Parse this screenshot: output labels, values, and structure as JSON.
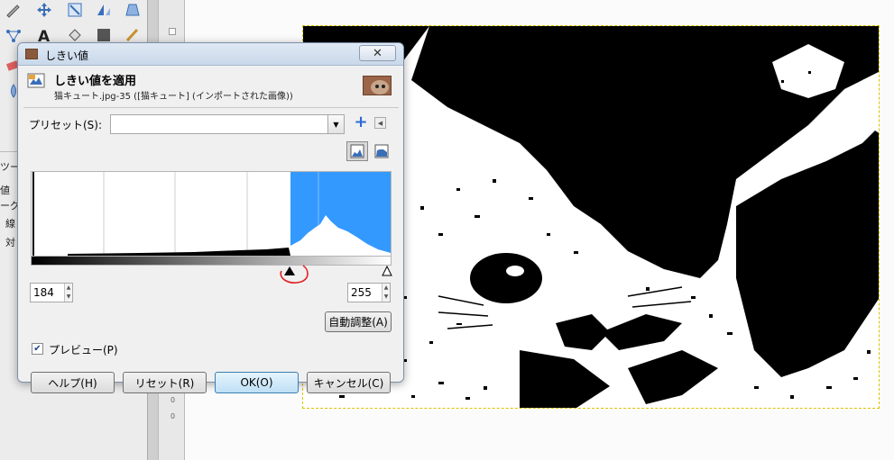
{
  "dialog": {
    "window_title": "しきい値",
    "close_label": "✕",
    "header_title": "しきい値を適用",
    "header_subtitle": "猫キュート.jpg-35 ([猫キュート] (インポートされた画像))",
    "preset_label": "プリセット(S):",
    "preset_value": "",
    "preset_add_icon": "plus-icon",
    "channel_low": "184",
    "channel_high": "255",
    "auto_button": "自動調整(A)",
    "preview_label": "プレビュー(P)",
    "preview_checked": true,
    "buttons": {
      "help": "ヘルプ(H)",
      "reset": "リセット(R)",
      "ok": "OK(O)",
      "cancel": "キャンセル(C)"
    },
    "histogram": {
      "threshold_low": 184,
      "threshold_high": 255,
      "range_max": 255,
      "selected_color": "#3399ff"
    }
  },
  "toolbox": {
    "side_labels": [
      "ツー",
      "値",
      "ーグ",
      "線",
      "対"
    ]
  },
  "colors": {
    "accent": "#3399ff",
    "annotation": "#e02020",
    "canvas_border": "#d9c400"
  }
}
